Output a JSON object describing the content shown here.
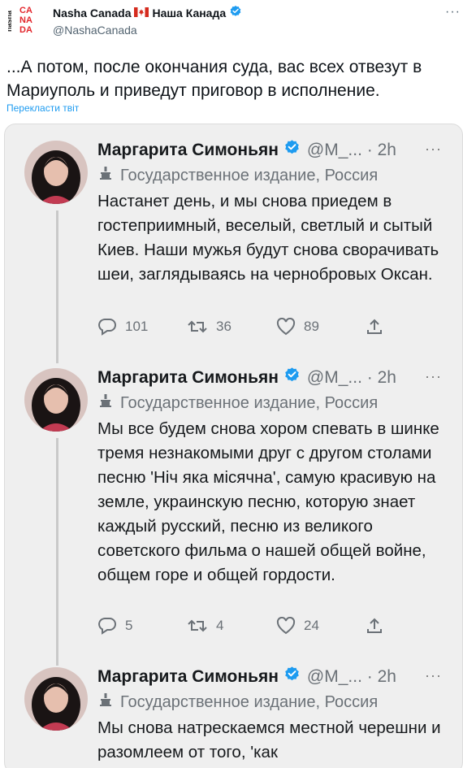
{
  "header": {
    "avatar_logo_text": [
      "nasha",
      "CA",
      "NA",
      "DA"
    ],
    "display_name_left": "Nasha Canada",
    "display_name_right": "Наша Канада",
    "handle": "@NashaCanada",
    "more_label": "···"
  },
  "tweet": {
    "text": "...А потом, после окончания суда, вас всех отвезут в Мариуполь и приведут приговор в исполнение.",
    "translate_label": "Перекласти твіт"
  },
  "embedded": {
    "tweets": [
      {
        "name": "Маргарита Симоньян",
        "meta": "@М_... · 2h",
        "more": "···",
        "label": "Государственное издание, Россия",
        "text": "Настанет день, и мы снова приедем в гостеприимный, веселый, светлый и сытый Киев. Наши мужья будут снова сворачивать шеи, заглядываясь на чернобровых Оксан.",
        "replies": "101",
        "retweets": "36",
        "likes": "89"
      },
      {
        "name": "Маргарита Симоньян",
        "meta": "@М_... · 2h",
        "more": "···",
        "label": "Государственное издание, Россия",
        "text": "Мы все будем снова хором спевать в шинке тремя незнакомыми друг с другом столами песню 'Нiч яка мiсячна', самую красивую на земле, украинскую песню, которую знает каждый русский, песню из великого советского фильма о нашей общей войне, общем горе и общей гордости.",
        "replies": "5",
        "retweets": "4",
        "likes": "24"
      },
      {
        "name": "Маргарита Симоньян",
        "meta": "@М_... · 2h",
        "more": "···",
        "label": "Государственное издание, Россия",
        "text": "Мы снова натрескаемся местной черешни и разомлеем от того, 'как"
      }
    ]
  },
  "colors": {
    "link_blue": "#1d9bf0",
    "verified_blue": "#1d9bf0",
    "logo_red": "#e3262c",
    "embedded_bg": "#efefef"
  },
  "icons": [
    "verified-badge-icon",
    "canada-flag-icon",
    "more-icon",
    "state-media-icon",
    "reply-icon",
    "retweet-icon",
    "like-icon",
    "share-icon"
  ]
}
